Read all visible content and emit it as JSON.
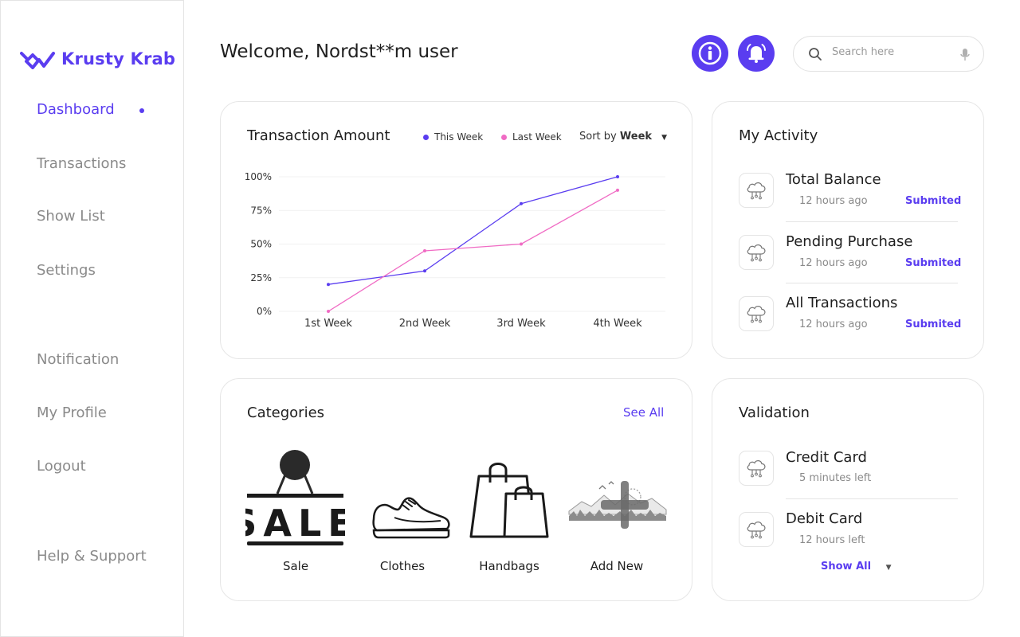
{
  "app": {
    "brand": "Krusty Krab",
    "accent": "#5a3df0"
  },
  "sidebar": {
    "items": [
      {
        "label": "Dashboard"
      },
      {
        "label": "Transactions"
      },
      {
        "label": "Show List"
      },
      {
        "label": "Settings"
      },
      {
        "label": "Notification"
      },
      {
        "label": "My Profile"
      },
      {
        "label": "Logout"
      },
      {
        "label": "Help & Support"
      }
    ],
    "active": "Dashboard"
  },
  "header": {
    "welcome": "Welcome, Nordst**m user",
    "info_icon": "info-icon",
    "bell_icon": "bell-icon",
    "search": {
      "placeholder": "Search here",
      "value": ""
    }
  },
  "transaction_card": {
    "title": "Transaction Amount",
    "legend_this": "This Week",
    "legend_last": "Last Week",
    "sort_prefix": "Sort by",
    "sort_value": "Week"
  },
  "chart_data": {
    "type": "line",
    "categories": [
      "1st Week",
      "2nd Week",
      "3rd Week",
      "4th Week"
    ],
    "y_ticks": [
      "0%",
      "25%",
      "50%",
      "75%",
      "100%"
    ],
    "ylim": [
      0,
      100
    ],
    "series": [
      {
        "name": "This Week",
        "color": "#5a3df0",
        "values": [
          20,
          30,
          80,
          100
        ]
      },
      {
        "name": "Last Week",
        "color": "#f06bc4",
        "values": [
          0,
          45,
          50,
          90
        ]
      }
    ],
    "grid": true
  },
  "activity": {
    "title": "My Activity",
    "items": [
      {
        "title": "Total Balance",
        "time": "12 hours ago",
        "status": "Submited"
      },
      {
        "title": "Pending Purchase",
        "time": "12 hours ago",
        "status": "Submited"
      },
      {
        "title": "All Transactions",
        "time": "12 hours ago",
        "status": "Submited"
      }
    ]
  },
  "categories": {
    "title": "Categories",
    "see_all": "See All",
    "items": [
      {
        "label": "Sale",
        "icon": "sale-sign-icon"
      },
      {
        "label": "Clothes",
        "icon": "sneaker-icon"
      },
      {
        "label": "Handbags",
        "icon": "shopping-bags-icon"
      },
      {
        "label": "Add New",
        "icon": "add-new-icon"
      }
    ],
    "sale_sign_text": "SALE"
  },
  "validation": {
    "title": "Validation",
    "items": [
      {
        "title": "Credit Card",
        "time": "5 minutes left"
      },
      {
        "title": "Debit Card",
        "time": "12 hours left"
      }
    ],
    "show_all": "Show All"
  }
}
